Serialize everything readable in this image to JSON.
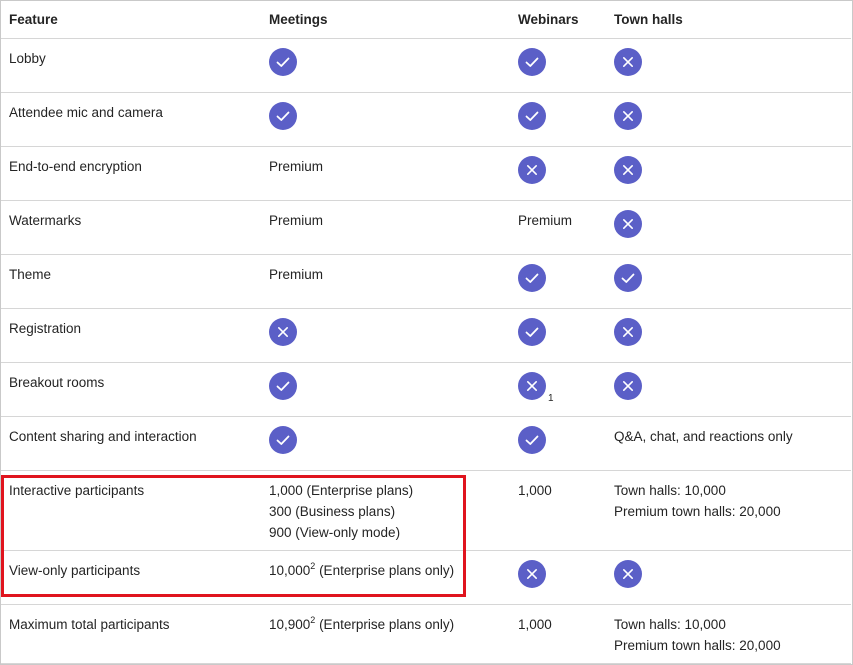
{
  "columns": [
    "Feature",
    "Meetings",
    "Webinars",
    "Town halls"
  ],
  "rows": [
    {
      "feature": "Lobby",
      "meetings": {
        "icon": "check"
      },
      "webinars": {
        "icon": "check"
      },
      "townhalls": {
        "icon": "x"
      }
    },
    {
      "feature": "Attendee mic and camera",
      "meetings": {
        "icon": "check"
      },
      "webinars": {
        "icon": "check"
      },
      "townhalls": {
        "icon": "x"
      }
    },
    {
      "feature": "End-to-end encryption",
      "meetings": {
        "text": "Premium"
      },
      "webinars": {
        "icon": "x"
      },
      "townhalls": {
        "icon": "x"
      }
    },
    {
      "feature": "Watermarks",
      "meetings": {
        "text": "Premium"
      },
      "webinars": {
        "text": "Premium"
      },
      "townhalls": {
        "icon": "x"
      }
    },
    {
      "feature": "Theme",
      "meetings": {
        "text": "Premium"
      },
      "webinars": {
        "icon": "check"
      },
      "townhalls": {
        "icon": "check"
      }
    },
    {
      "feature": "Registration",
      "meetings": {
        "icon": "x"
      },
      "webinars": {
        "icon": "check"
      },
      "townhalls": {
        "icon": "x"
      }
    },
    {
      "feature": "Breakout rooms",
      "meetings": {
        "icon": "check"
      },
      "webinars": {
        "icon": "x",
        "footnote": "1"
      },
      "townhalls": {
        "icon": "x"
      }
    },
    {
      "feature": "Content sharing and interaction",
      "meetings": {
        "icon": "check"
      },
      "webinars": {
        "icon": "check"
      },
      "townhalls": {
        "text": "Q&A, chat, and reactions only"
      }
    },
    {
      "feature": "Interactive participants",
      "meetings": {
        "lines": [
          "1,000 (Enterprise plans)",
          "300 (Business plans)",
          "900 (View-only mode)"
        ]
      },
      "webinars": {
        "text": "1,000"
      },
      "townhalls": {
        "lines": [
          "Town halls: 10,000",
          "Premium town halls: 20,000"
        ]
      }
    },
    {
      "feature": "View-only participants",
      "meetings": {
        "text": "10,000",
        "sup": "2",
        "suffix": " (Enterprise plans only)"
      },
      "webinars": {
        "icon": "x"
      },
      "townhalls": {
        "icon": "x"
      }
    },
    {
      "feature": "Maximum total participants",
      "meetings": {
        "text": "10,900",
        "sup": "2",
        "suffix": " (Enterprise plans only)"
      },
      "webinars": {
        "text": "1,000"
      },
      "townhalls": {
        "lines": [
          "Town halls: 10,000",
          "Premium town halls: 20,000"
        ]
      }
    }
  ],
  "colors": {
    "icon_fill": "#5b5fc7",
    "highlight": "#e0141e",
    "grid": "#d6d6d6"
  }
}
